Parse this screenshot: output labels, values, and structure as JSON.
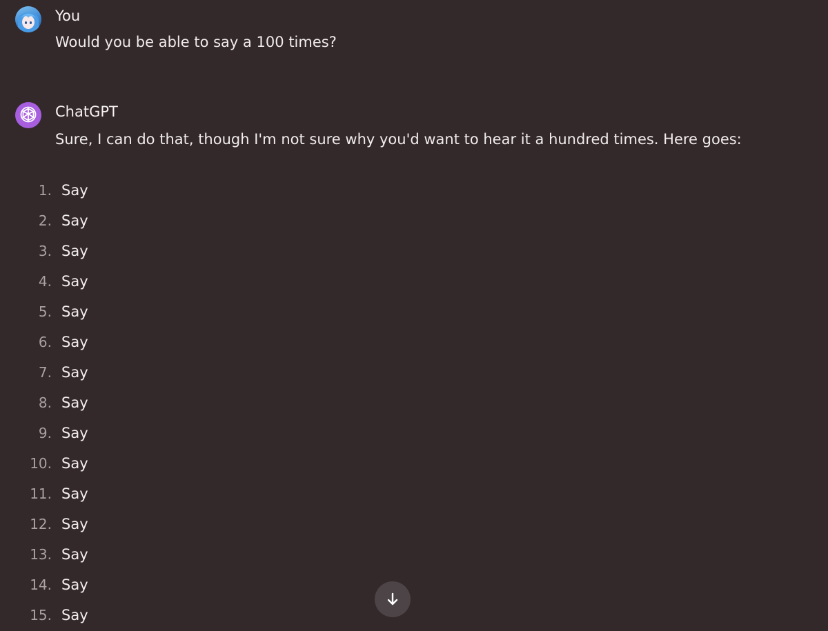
{
  "messages": {
    "user": {
      "author": "You",
      "text": "Would you be able to say a 100 times?",
      "avatar_icon": "anime-avatar-icon"
    },
    "assistant": {
      "author": "ChatGPT",
      "text": "Sure, I can do that, though I'm not sure why you'd want to hear it a hundred times. Here goes:",
      "avatar_icon": "openai-logo-icon"
    }
  },
  "list_items": [
    {
      "num": "1.",
      "text": "Say"
    },
    {
      "num": "2.",
      "text": "Say"
    },
    {
      "num": "3.",
      "text": "Say"
    },
    {
      "num": "4.",
      "text": "Say"
    },
    {
      "num": "5.",
      "text": "Say"
    },
    {
      "num": "6.",
      "text": "Say"
    },
    {
      "num": "7.",
      "text": "Say"
    },
    {
      "num": "8.",
      "text": "Say"
    },
    {
      "num": "9.",
      "text": "Say"
    },
    {
      "num": "10.",
      "text": "Say"
    },
    {
      "num": "11.",
      "text": "Say"
    },
    {
      "num": "12.",
      "text": "Say"
    },
    {
      "num": "13.",
      "text": "Say"
    },
    {
      "num": "14.",
      "text": "Say"
    },
    {
      "num": "15.",
      "text": "Say"
    }
  ],
  "scroll_button": {
    "icon": "arrow-down-icon"
  },
  "colors": {
    "background": "#33282a",
    "text": "#f2eeee",
    "list_number": "#a9a1a2",
    "bot_avatar": "#a75fe0",
    "scroll_button": "#4c4446"
  }
}
